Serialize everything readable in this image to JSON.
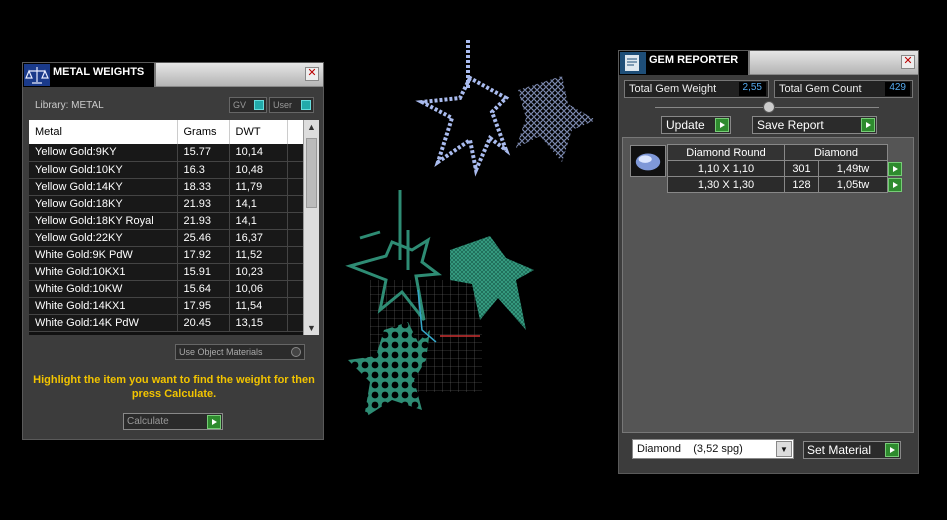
{
  "metal_panel": {
    "title": "METAL WEIGHTS",
    "close_glyph": "✕",
    "library_label": "Library: METAL",
    "toggle_gv": "GV",
    "toggle_user": "User",
    "columns": [
      "Metal",
      "Grams",
      "DWT"
    ],
    "rows": [
      [
        "Yellow Gold:9KY",
        "15.77",
        "10,14"
      ],
      [
        "Yellow Gold:10KY",
        "16.3",
        "10,48"
      ],
      [
        "Yellow Gold:14KY",
        "18.33",
        "11,79"
      ],
      [
        "Yellow Gold:18KY",
        "21.93",
        "14,1"
      ],
      [
        "Yellow Gold:18KY Royal",
        "21.93",
        "14,1"
      ],
      [
        "Yellow Gold:22KY",
        "25.46",
        "16,37"
      ],
      [
        "White Gold:9K PdW",
        "17.92",
        "11,52"
      ],
      [
        "White Gold:10KX1",
        "15.91",
        "10,23"
      ],
      [
        "White Gold:10KW",
        "15.64",
        "10,06"
      ],
      [
        "White Gold:14KX1",
        "17.95",
        "11,54"
      ],
      [
        "White Gold:14K PdW",
        "20.45",
        "13,15"
      ]
    ],
    "use_object_materials": "Use Object Materials",
    "hint": "Highlight the item you want to find the weight for then press Calculate.",
    "calculate_label": "Calculate"
  },
  "gem_panel": {
    "title": "GEM REPORTER",
    "close_glyph": "✕",
    "total_weight_label": "Total Gem Weight",
    "total_weight_value": "2,55",
    "total_count_label": "Total Gem Count",
    "total_count_value": "429",
    "update_label": "Update",
    "save_report_label": "Save Report",
    "table_headers": [
      "Diamond Round",
      "Diamond"
    ],
    "table_rows": [
      [
        "1,10 X 1,10",
        "301",
        "1,49tw"
      ],
      [
        "1,30 X 1,30",
        "128",
        "1,05tw"
      ]
    ],
    "material_value": "Diamond    (3,52 spg)",
    "set_material_label": "Set Material"
  },
  "colors": {
    "hint_yellow": "#f2c400",
    "button_green": "#2e8b2e",
    "value_blue": "#55aaee",
    "gem_blue": "#9fb3e8",
    "mesh_teal": "#2e8c74"
  }
}
